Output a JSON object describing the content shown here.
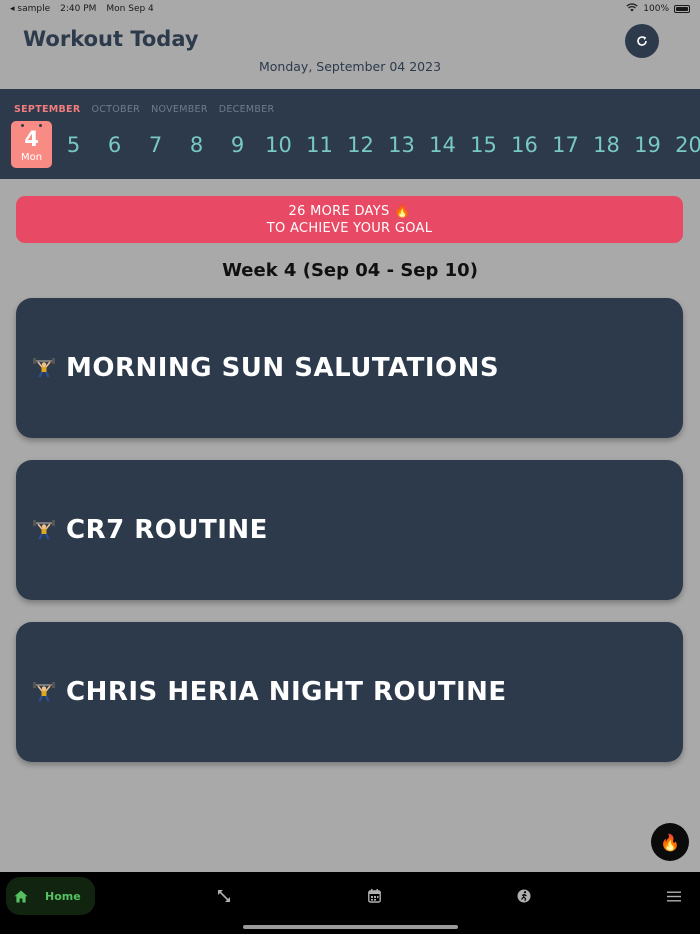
{
  "status_bar": {
    "back_app": "sample",
    "time": "2:40 PM",
    "date": "Mon Sep 4",
    "battery": "100%"
  },
  "header": {
    "title": "Workout Today",
    "date": "Monday, September 04 2023"
  },
  "calendar": {
    "months": [
      "SEPTEMBER",
      "OCTOBER",
      "NOVEMBER",
      "DECEMBER"
    ],
    "selected_day": {
      "num": "4",
      "weekday": "Mon"
    },
    "days": [
      "5",
      "6",
      "7",
      "8",
      "9",
      "10",
      "11",
      "12",
      "13",
      "14",
      "15",
      "16",
      "17",
      "18",
      "19",
      "20"
    ]
  },
  "goal": {
    "line1": "26 MORE DAYS 🔥",
    "line2": "TO ACHIEVE YOUR GOAL"
  },
  "week": {
    "title": "Week 4 (Sep 04 - Sep 10)"
  },
  "routines": [
    {
      "name": "MORNING SUN SALUTATIONS"
    },
    {
      "name": "CR7 ROUTINE"
    },
    {
      "name": "CHRIS HERIA NIGHT ROUTINE"
    }
  ],
  "fab": {
    "icon": "fire-icon",
    "glyph": "🔥"
  },
  "nav": {
    "home_label": "Home"
  },
  "colors": {
    "background": "#a9a9a9",
    "navy": "#2d3a4c",
    "accent_red": "#e84a65",
    "selected_day": "#f88b84",
    "day_text": "#79c9c3",
    "nav_active": "#56c161"
  }
}
